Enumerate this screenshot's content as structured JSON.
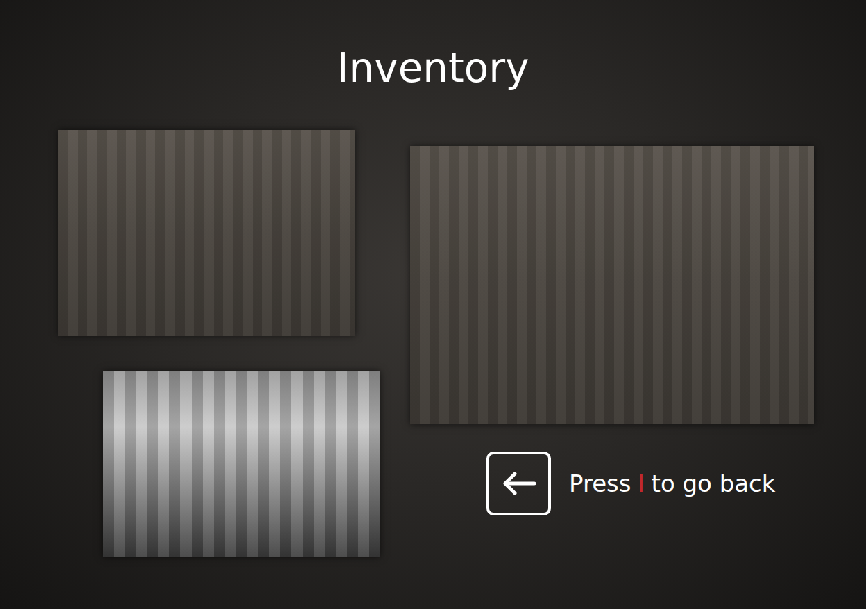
{
  "screen": {
    "title": "Inventory"
  },
  "items": [
    {
      "kind": "photo",
      "dimmed": true
    },
    {
      "kind": "photo",
      "dimmed": true
    },
    {
      "kind": "photo",
      "dimmed": false
    }
  ],
  "hint": {
    "before": "Press",
    "key": "I",
    "after": "to go back"
  }
}
